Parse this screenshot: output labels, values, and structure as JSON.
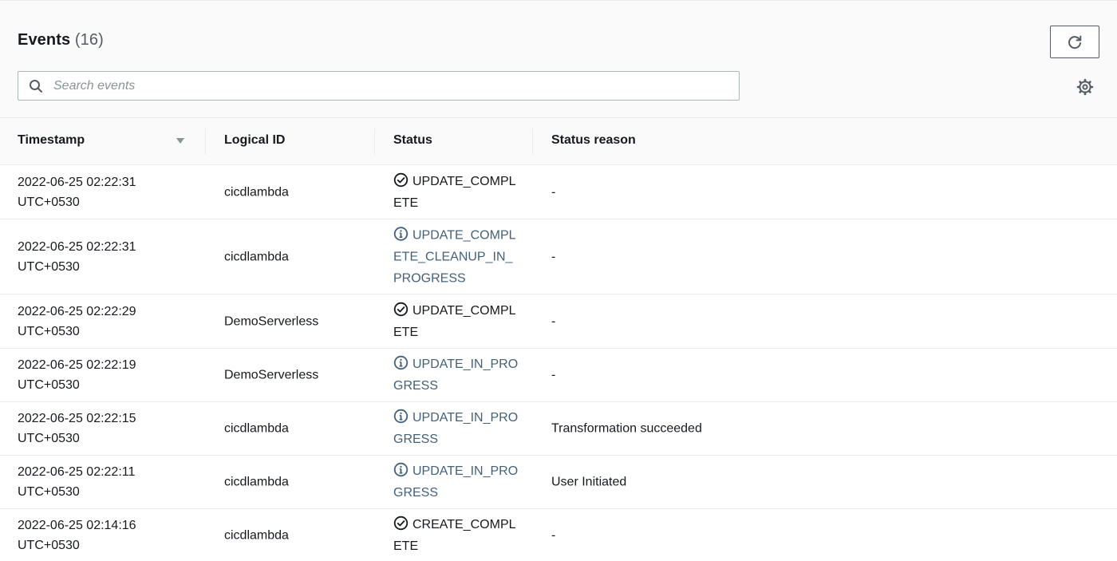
{
  "header": {
    "title": "Events",
    "count": "(16)",
    "search_placeholder": "Search events"
  },
  "columns": {
    "timestamp": "Timestamp",
    "logical_id": "Logical ID",
    "status": "Status",
    "status_reason": "Status reason"
  },
  "icons": {
    "refresh": "refresh-icon",
    "search": "search-icon",
    "settings": "gear-icon",
    "sort": "sort-descending-icon",
    "success": "check-circle-icon",
    "info": "info-circle-icon"
  },
  "colors": {
    "success": "#1d8102",
    "info": "#44617b",
    "text": "#16191f"
  },
  "rows": [
    {
      "ts1": "2022-06-25 02:22:31",
      "ts2": "UTC+0530",
      "logical_id": "cicdlambda",
      "status": "UPDATE_COMPLETE",
      "type": "success",
      "reason": "-"
    },
    {
      "ts1": "2022-06-25 02:22:31",
      "ts2": "UTC+0530",
      "logical_id": "cicdlambda",
      "status": "UPDATE_COMPLETE_CLEANUP_IN_PROGRESS",
      "type": "info",
      "reason": "-"
    },
    {
      "ts1": "2022-06-25 02:22:29",
      "ts2": "UTC+0530",
      "logical_id": "DemoServerless",
      "status": "UPDATE_COMPLETE",
      "type": "success",
      "reason": "-"
    },
    {
      "ts1": "2022-06-25 02:22:19",
      "ts2": "UTC+0530",
      "logical_id": "DemoServerless",
      "status": "UPDATE_IN_PROGRESS",
      "type": "info",
      "reason": "-"
    },
    {
      "ts1": "2022-06-25 02:22:15",
      "ts2": "UTC+0530",
      "logical_id": "cicdlambda",
      "status": "UPDATE_IN_PROGRESS",
      "type": "info",
      "reason": "Transformation succeeded"
    },
    {
      "ts1": "2022-06-25 02:22:11",
      "ts2": "UTC+0530",
      "logical_id": "cicdlambda",
      "status": "UPDATE_IN_PROGRESS",
      "type": "info",
      "reason": "User Initiated"
    },
    {
      "ts1": "2022-06-25 02:14:16",
      "ts2": "UTC+0530",
      "logical_id": "cicdlambda",
      "status": "CREATE_COMPLETE",
      "type": "success",
      "reason": "-"
    }
  ]
}
